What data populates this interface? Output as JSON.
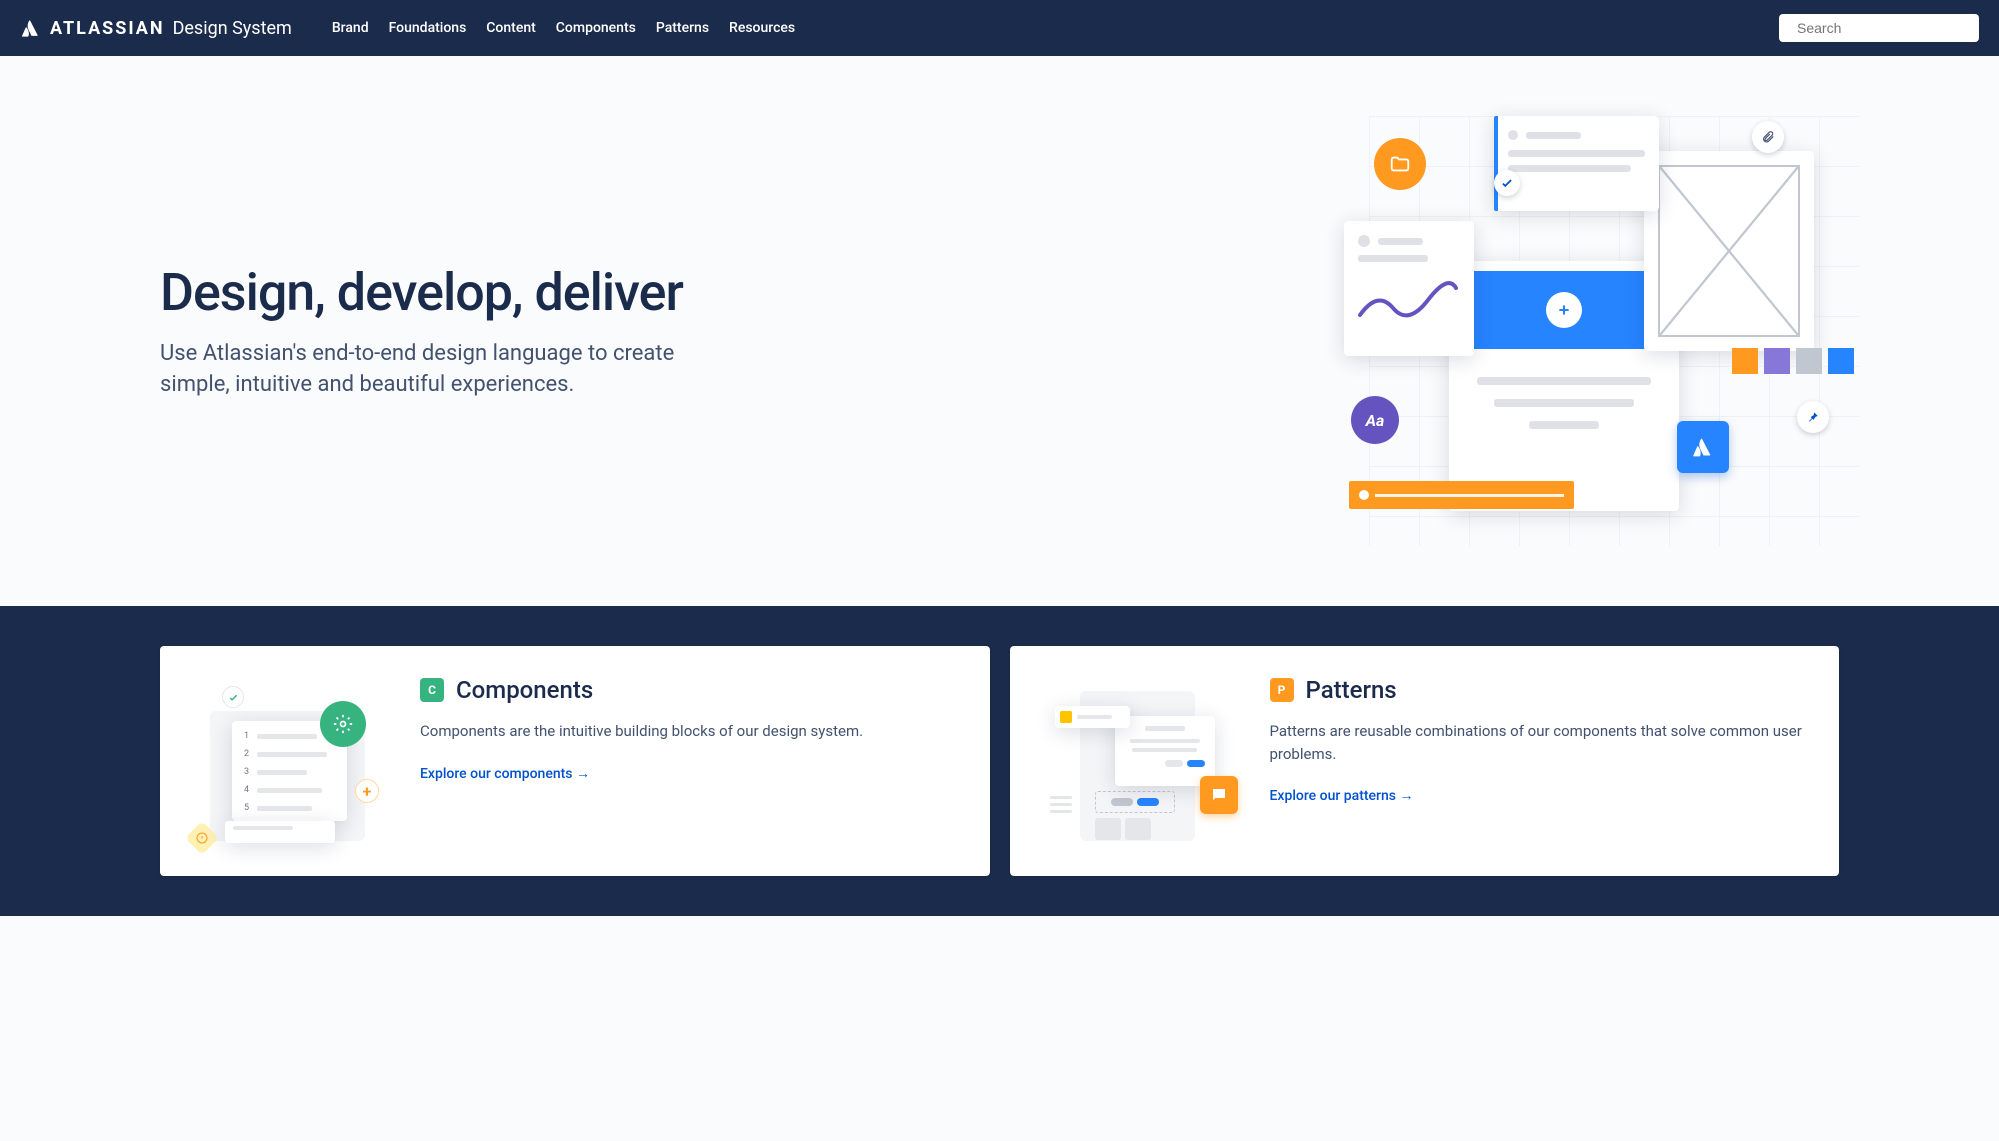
{
  "header": {
    "brand_bold": "ATLASSIAN",
    "brand_light": "Design System",
    "nav": [
      "Brand",
      "Foundations",
      "Content",
      "Components",
      "Patterns",
      "Resources"
    ],
    "search_placeholder": "Search"
  },
  "hero": {
    "title": "Design, develop, deliver",
    "subtitle": "Use Atlassian's end-to-end design language to create simple, intuitive and beautiful experiences."
  },
  "cards": [
    {
      "badge": "C",
      "badge_color": "#36B37E",
      "title": "Components",
      "desc": "Components are the intuitive building blocks of our design system.",
      "link": "Explore our components →"
    },
    {
      "badge": "P",
      "badge_color": "#FF991F",
      "title": "Patterns",
      "desc": "Patterns are reusable combinations of our components that solve common user problems.",
      "link": "Explore our patterns →"
    }
  ],
  "colors": {
    "orange": "#FF991F",
    "blue": "#2684FF",
    "purple": "#6554C0",
    "gray": "#DFE1E6",
    "navy": "#1B2B4C"
  }
}
